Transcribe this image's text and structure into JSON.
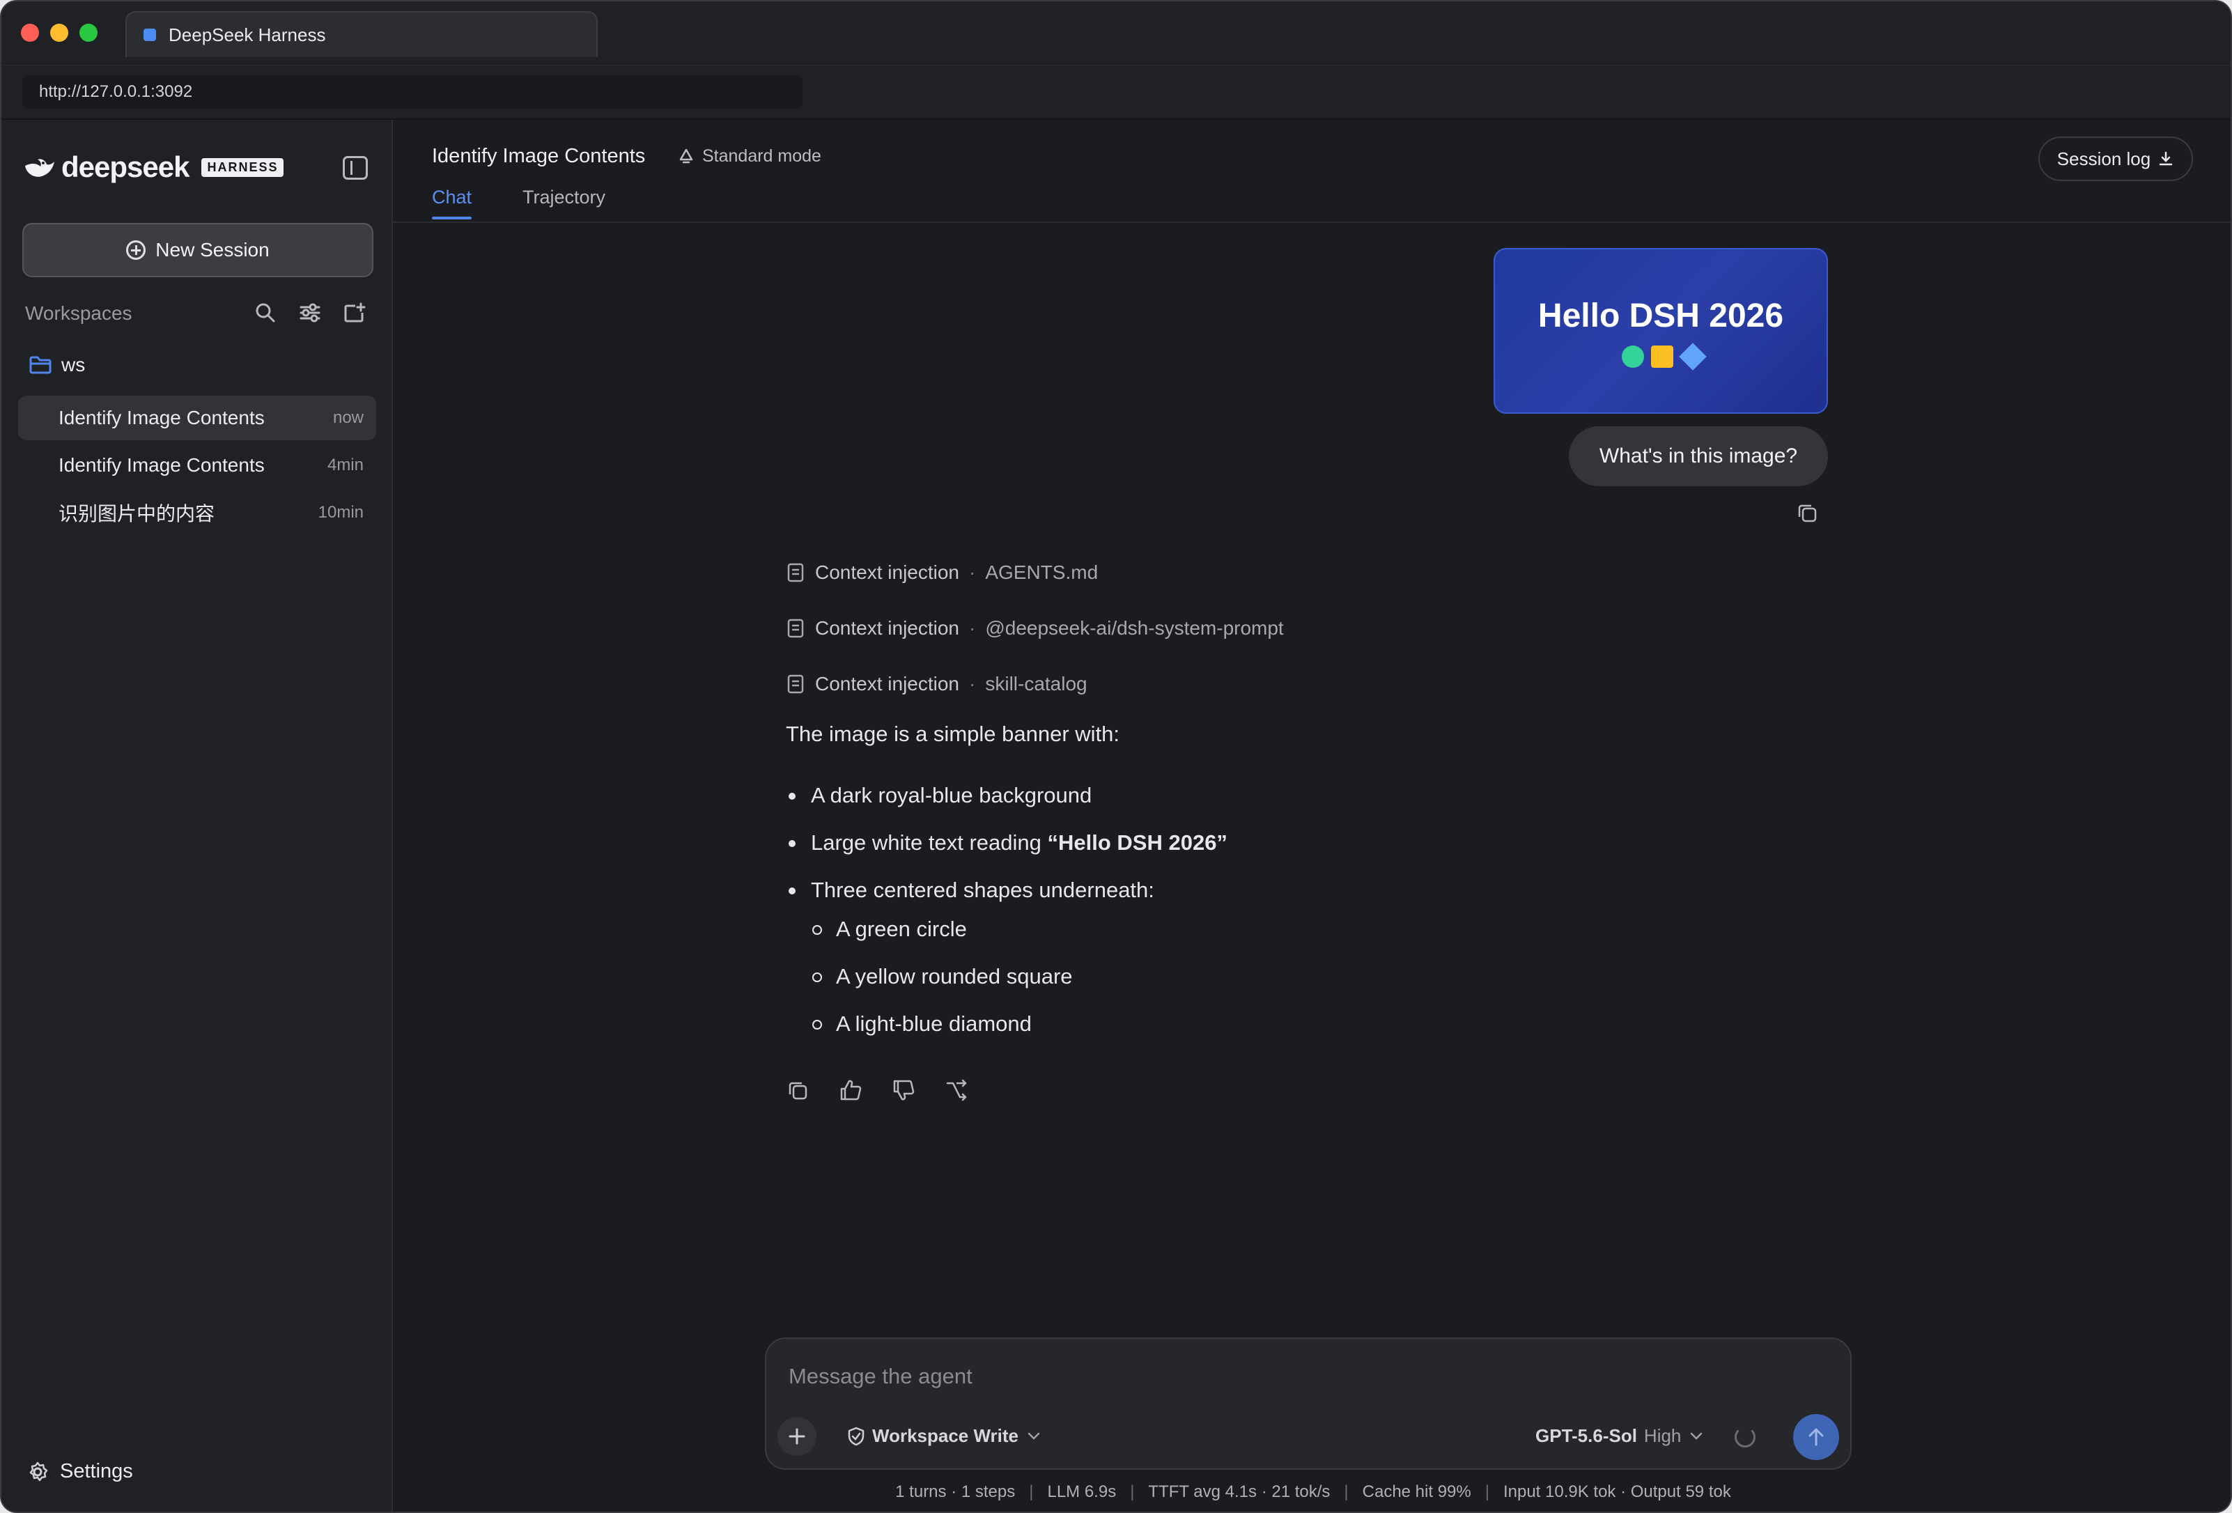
{
  "browser": {
    "tab_title": "DeepSeek Harness",
    "url": "http://127.0.0.1:3092"
  },
  "sidebar": {
    "brand": "deepseek",
    "badge": "HARNESS",
    "new_session_label": "New Session",
    "workspaces_label": "Workspaces",
    "folder": "ws",
    "sessions": [
      {
        "title": "Identify Image Contents",
        "time": "now",
        "active": true
      },
      {
        "title": "Identify Image Contents",
        "time": "4min",
        "active": false
      },
      {
        "title": "识别图片中的内容",
        "time": "10min",
        "active": false
      }
    ],
    "settings_label": "Settings"
  },
  "header": {
    "title": "Identify Image Contents",
    "mode": "Standard mode",
    "tabs": [
      "Chat",
      "Trajectory"
    ],
    "active_tab": "Chat",
    "session_log_label": "Session log"
  },
  "conversation": {
    "image_text": "Hello DSH 2026",
    "user_message": "What's in this image?",
    "context_injections": [
      {
        "label": "Context injection",
        "value": "AGENTS.md"
      },
      {
        "label": "Context injection",
        "value": "@deepseek-ai/dsh-system-prompt"
      },
      {
        "label": "Context injection",
        "value": "skill-catalog"
      }
    ],
    "answer": {
      "intro": "The image is a simple banner with:",
      "b1": "A dark royal-blue background",
      "b2_prefix": "Large white text reading ",
      "b2_bold": "“Hello DSH 2026”",
      "b3": "Three centered shapes underneath:",
      "sub1": "A green circle",
      "sub2": "A yellow rounded square",
      "sub3": "A light-blue diamond"
    }
  },
  "composer": {
    "placeholder": "Message the agent",
    "permission": "Workspace Write",
    "model": "GPT-5.6-Sol",
    "effort": "High"
  },
  "status": {
    "turns": "1 turns · 1 steps",
    "llm": "LLM 6.9s",
    "ttft": "TTFT avg 4.1s · 21 tok/s",
    "cache": "Cache hit 99%",
    "tokens": "Input 10.9K tok · Output 59 tok"
  },
  "colors": {
    "accent": "#4f86ec",
    "banner_bg": "#2b3fa8",
    "circle": "#34d399",
    "square": "#fbbf24",
    "diamond": "#60a5fa"
  }
}
